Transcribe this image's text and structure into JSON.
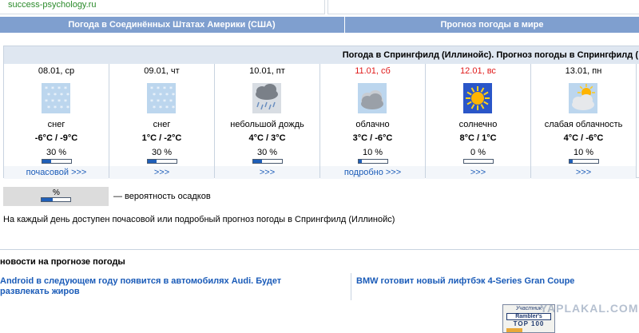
{
  "header": {
    "site_url": "success-psychology.ru"
  },
  "nav": {
    "usa": "Погода в Соединённых Штатах Америки (США)",
    "world": "Прогноз погоды в мире"
  },
  "forecast": {
    "title": "Погода в Спрингфилд (Иллинойс). Прогноз погоды в Спрингфилд (",
    "days": [
      {
        "date": "08.01, ср",
        "weekend": false,
        "icon": "snow-icon",
        "condition": "снег",
        "temp": "-6°C / -9°C",
        "precip": "30 %",
        "precip_value": 30,
        "link": "почасовой >>>"
      },
      {
        "date": "09.01, чт",
        "weekend": false,
        "icon": "snow-icon",
        "condition": "снег",
        "temp": "1°C / -2°C",
        "precip": "30 %",
        "precip_value": 30,
        "link": ">>>"
      },
      {
        "date": "10.01, пт",
        "weekend": false,
        "icon": "light-rain-icon",
        "condition": "небольшой дождь",
        "temp": "4°C / 3°C",
        "precip": "30 %",
        "precip_value": 30,
        "link": ">>>"
      },
      {
        "date": "11.01, сб",
        "weekend": true,
        "icon": "cloudy-icon",
        "condition": "облачно",
        "temp": "3°C / -6°C",
        "precip": "10 %",
        "precip_value": 10,
        "link": "подробно >>>"
      },
      {
        "date": "12.01, вс",
        "weekend": true,
        "icon": "sun-icon",
        "condition": "солнечно",
        "temp": "8°C / 1°C",
        "precip": "0 %",
        "precip_value": 0,
        "link": ">>>"
      },
      {
        "date": "13.01, пн",
        "weekend": false,
        "icon": "partly-cloudy-icon",
        "condition": "слабая облачность",
        "temp": "4°C / -6°C",
        "precip": "10 %",
        "precip_value": 10,
        "link": ">>>"
      }
    ]
  },
  "legend": {
    "symbol": "%",
    "text": "— вероятность осадков"
  },
  "note": "На каждый день доступен почасовой или подробный прогноз погоды в Спрингфилд (Иллинойс)",
  "news": {
    "title": "новости на прогнозе погоды",
    "items": [
      "Android в следующем году появится в автомобилях Audi. Будет развлекать жиров",
      "BMW готовит новый лифтбэк 4-Series Gran Coupe"
    ]
  },
  "counter": {
    "line1": "Участник",
    "line2": "Rambler's",
    "line3": "TOP 100"
  },
  "watermark": "YAPLAKAL.COM",
  "colors": {
    "nav_bg": "#7f9fcf",
    "link": "#1a5bb8",
    "weekend": "#e01a1a",
    "bar_fill": "#1f5fb8"
  }
}
